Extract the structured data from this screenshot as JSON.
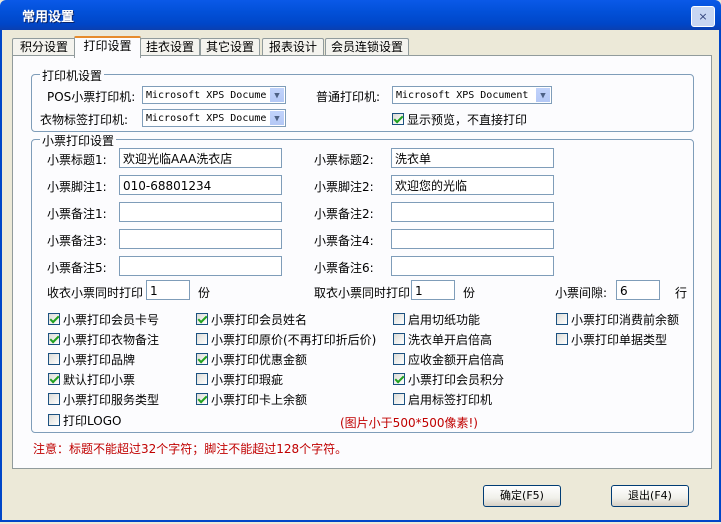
{
  "window": {
    "title": "常用设置",
    "close_label": "×"
  },
  "tabs": [
    "积分设置",
    "打印设置",
    "挂衣设置",
    "其它设置",
    "报表设计",
    "会员连锁设置"
  ],
  "printer_group": {
    "legend": "打印机设置",
    "pos_label": "POS小票打印机:",
    "pos_value": "Microsoft XPS Document",
    "normal_label": "普通打印机:",
    "normal_value": "Microsoft XPS Document",
    "tag_label": "衣物标签打印机:",
    "tag_value": "Microsoft XPS Document",
    "preview_label": "显示预览，不直接打印",
    "preview_checked": true
  },
  "ticket_group": {
    "legend": "小票打印设置",
    "title1_label": "小票标题1:",
    "title1_value": "欢迎光临AAA洗衣店",
    "title2_label": "小票标题2:",
    "title2_value": "洗衣单",
    "foot1_label": "小票脚注1:",
    "foot1_value": "010-68801234",
    "foot2_label": "小票脚注2:",
    "foot2_value": "欢迎您的光临",
    "remark1_label": "小票备注1:",
    "remark1_value": "",
    "remark2_label": "小票备注2:",
    "remark2_value": "",
    "remark3_label": "小票备注3:",
    "remark3_value": "",
    "remark4_label": "小票备注4:",
    "remark4_value": "",
    "remark5_label": "小票备注5:",
    "remark5_value": "",
    "remark6_label": "小票备注6:",
    "remark6_value": "",
    "recv_label": "收衣小票同时打印",
    "recv_value": "1",
    "recv_unit": "份",
    "take_label": "取衣小票同时打印",
    "take_value": "1",
    "take_unit": "份",
    "gap_label": "小票间隙:",
    "gap_value": "6",
    "gap_unit": "行",
    "checkboxes": [
      {
        "label": "小票打印会员卡号",
        "checked": true
      },
      {
        "label": "小票打印会员姓名",
        "checked": true
      },
      {
        "label": "启用切纸功能",
        "checked": false
      },
      {
        "label": "小票打印消费前余额",
        "checked": false
      },
      {
        "label": "小票打印衣物备注",
        "checked": true
      },
      {
        "label": "小票打印原价(不再打印折后价)",
        "checked": false
      },
      {
        "label": "洗衣单开启倍高",
        "checked": false
      },
      {
        "label": "小票打印单据类型",
        "checked": false
      },
      {
        "label": "小票打印品牌",
        "checked": false
      },
      {
        "label": "小票打印优惠金额",
        "checked": true
      },
      {
        "label": "应收金额开启倍高",
        "checked": false
      },
      {
        "label": "默认打印小票",
        "checked": true
      },
      {
        "label": "小票打印瑕疵",
        "checked": false
      },
      {
        "label": "小票打印会员积分",
        "checked": true
      },
      {
        "label": "小票打印服务类型",
        "checked": false
      },
      {
        "label": "小票打印卡上余额",
        "checked": true
      },
      {
        "label": "启用标签打印机",
        "checked": false
      },
      {
        "label": "打印LOGO",
        "checked": false
      }
    ],
    "logo_hint": "(图片小于500*500像素!)"
  },
  "note": "注意：标题不能超过32个字符；脚注不能超过128个字符。",
  "buttons": {
    "ok": "确定(F5)",
    "exit": "退出(F4)"
  },
  "colors": {
    "accent": "#0046c8",
    "warn": "#c00000",
    "check": "#21a121"
  }
}
